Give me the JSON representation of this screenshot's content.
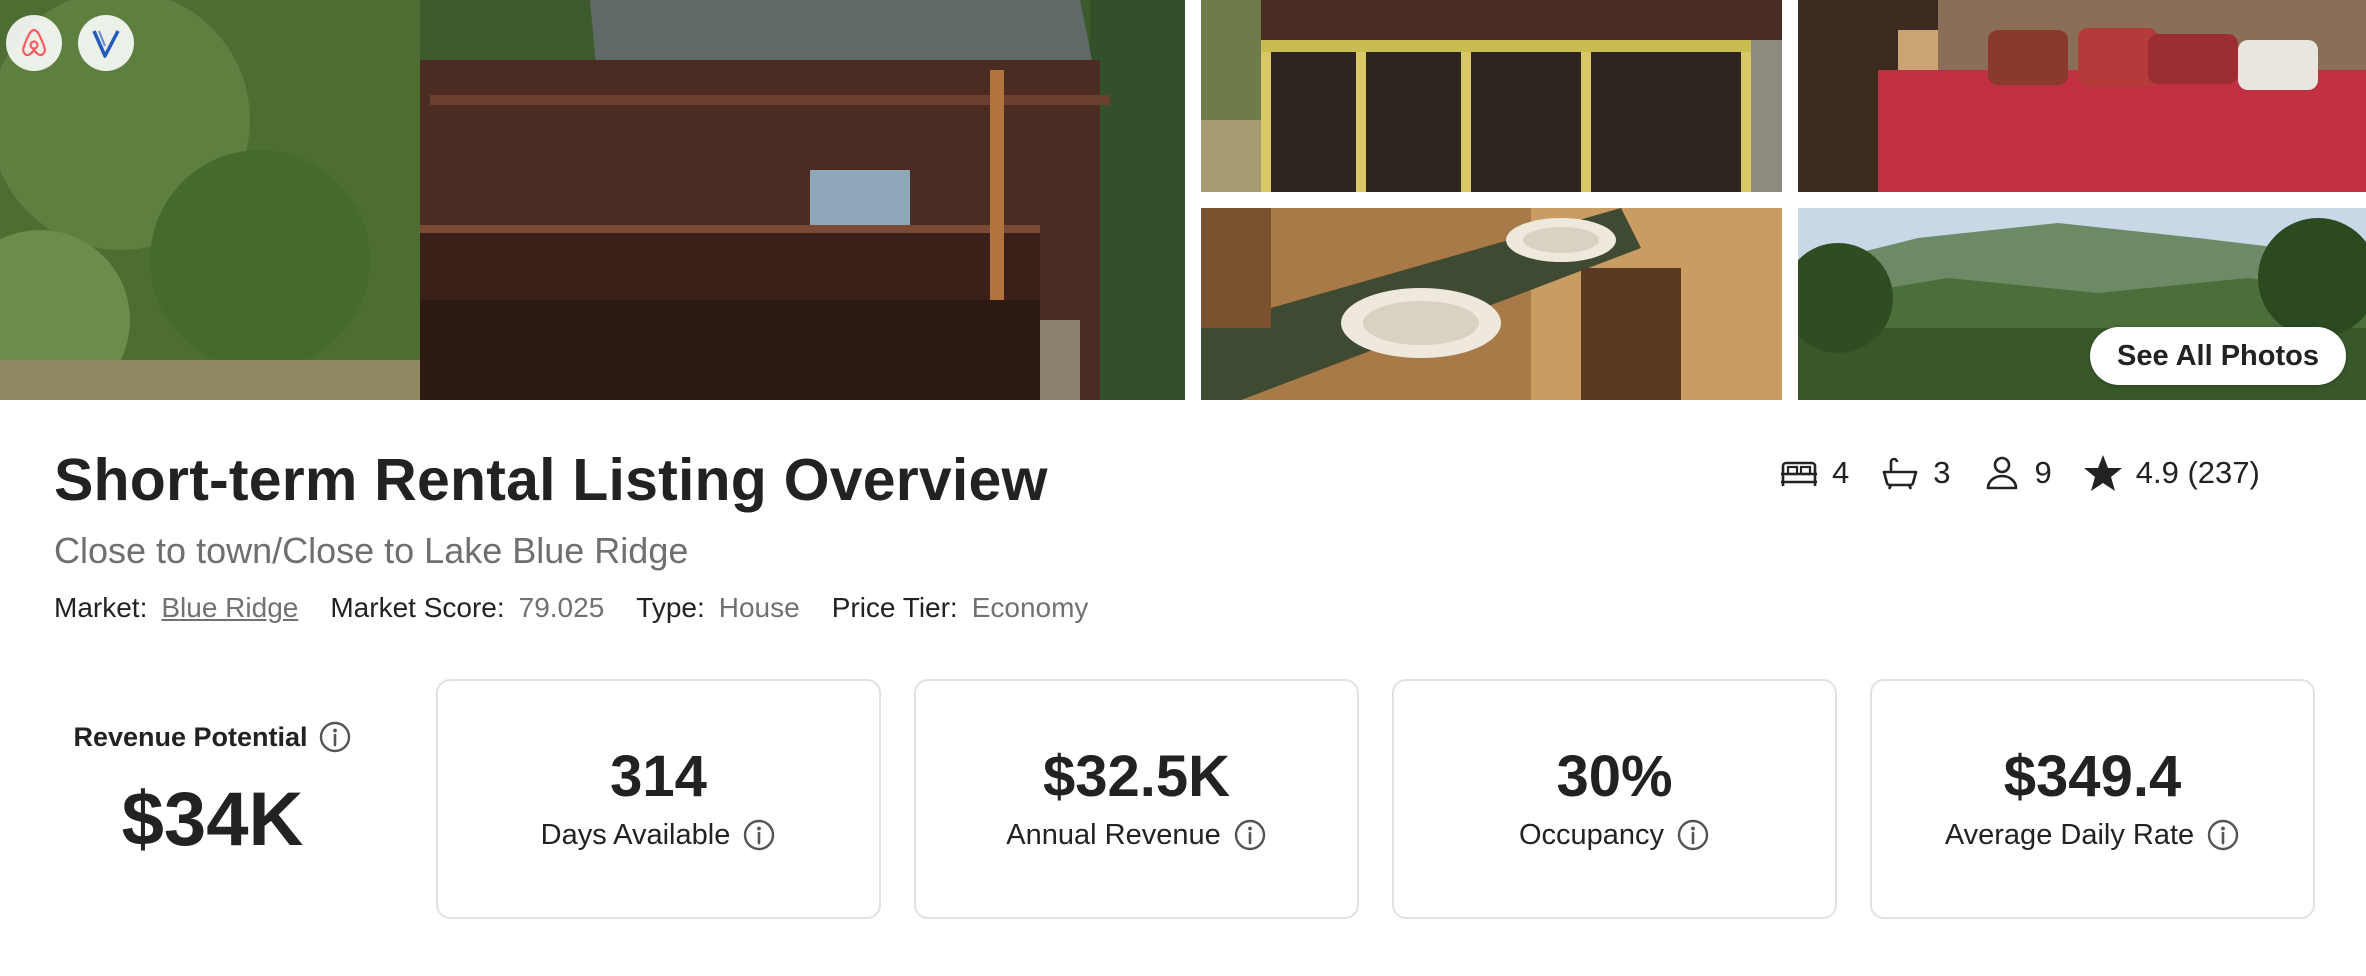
{
  "gallery": {
    "see_all_label": "See All Photos",
    "logos": [
      "airbnb-logo",
      "vrbo-logo"
    ],
    "photos": [
      "cabin-exterior-photo",
      "deck-photo",
      "bedroom-photo",
      "bathroom-photo",
      "mountain-view-photo"
    ]
  },
  "listing": {
    "title": "Short-term Rental Listing Overview",
    "subtitle": "Close to town/Close to Lake Blue Ridge",
    "market_label": "Market:",
    "market_value": "Blue Ridge",
    "market_score_label": "Market Score:",
    "market_score_value": "79.025",
    "type_label": "Type:",
    "type_value": "House",
    "price_tier_label": "Price Tier:",
    "price_tier_value": "Economy"
  },
  "stats": {
    "bedrooms": "4",
    "bathrooms": "3",
    "guests": "9",
    "rating": "4.9 (237)"
  },
  "metrics": {
    "revenue_potential_label": "Revenue Potential",
    "revenue_potential_value": "$34K",
    "cards": [
      {
        "value": "314",
        "label": "Days Available"
      },
      {
        "value": "$32.5K",
        "label": "Annual Revenue"
      },
      {
        "value": "30%",
        "label": "Occupancy"
      },
      {
        "value": "$349.4",
        "label": "Average Daily Rate"
      }
    ]
  },
  "colors": {
    "text": "#222222",
    "muted": "#717171",
    "card_border": "#e2e2e2",
    "airbnb_brand": "#ff5a5f",
    "vrbo_brand": "#245abc"
  }
}
